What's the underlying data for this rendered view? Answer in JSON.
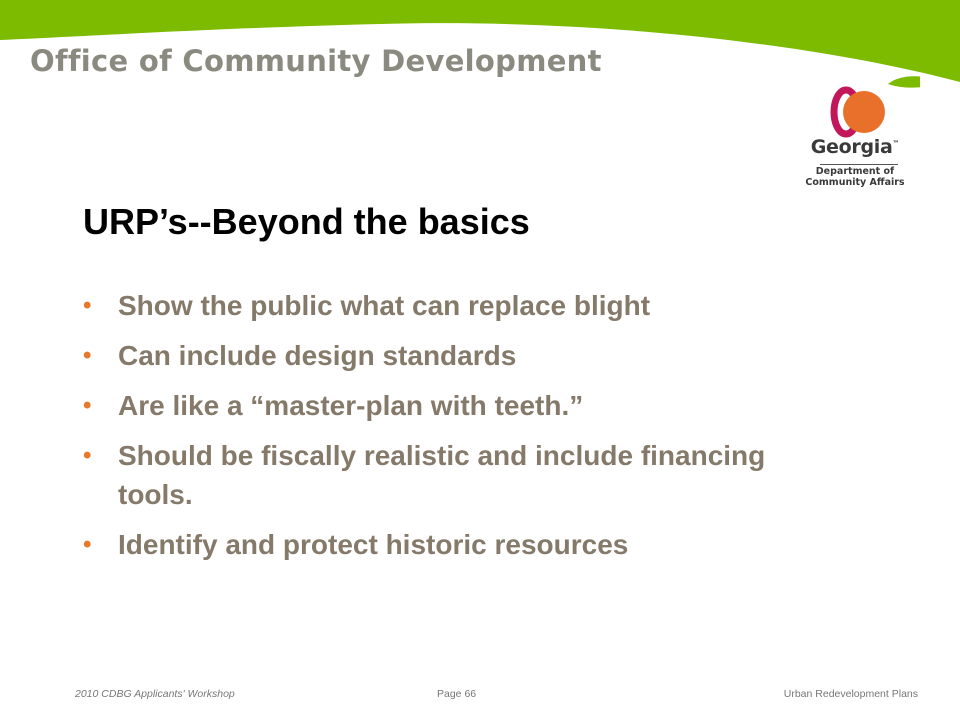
{
  "header": {
    "org_name": "Office of Community Development",
    "colors": {
      "swoosh_green": "#7cbb00",
      "org_text": "#8a8a80"
    }
  },
  "logo": {
    "wordmark": "Georgia",
    "trademark": "™",
    "line1": "Department of",
    "line2": "Community Affairs",
    "icon": "peach-icon"
  },
  "slide": {
    "title": "URP’s--Beyond the basics",
    "bullets": [
      {
        "text": "Show the public what can replace blight"
      },
      {
        "text": "Can include design standards"
      },
      {
        "text": "Are like a “master-plan with teeth.”"
      },
      {
        "text": "Should be fiscally realistic and include financing tools."
      },
      {
        "text": "Identify and protect historic resources"
      }
    ],
    "bullet_glyph": "•",
    "colors": {
      "title": "#000000",
      "bullet_text": "#857a6a",
      "bullet_dot": "#e8782a"
    }
  },
  "footer": {
    "left": "2010 CDBG Applicants' Workshop",
    "center": "Page 66",
    "right": "Urban Redevelopment Plans"
  }
}
